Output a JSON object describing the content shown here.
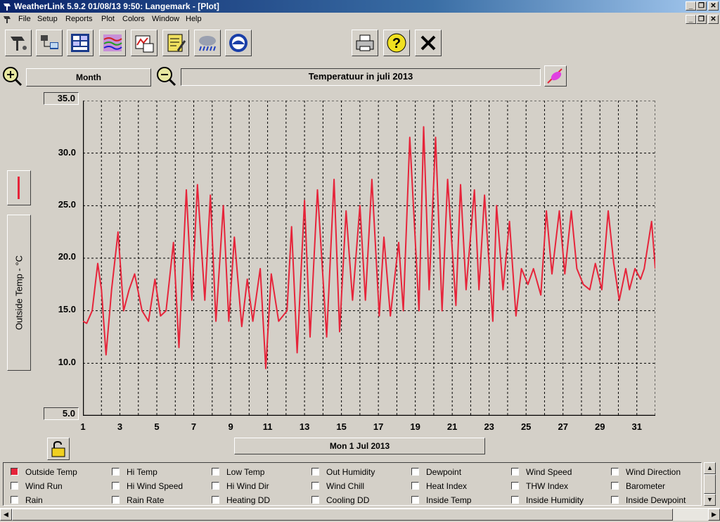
{
  "window": {
    "title": "WeatherLink 5.9.2  01/08/13  9:50: Langemark - [Plot]"
  },
  "menu": [
    "File",
    "Setup",
    "Reports",
    "Plot",
    "Colors",
    "Window",
    "Help"
  ],
  "toolbar_icons": [
    "station-icon",
    "download-icon",
    "bulletin-icon",
    "strip-chart-icon",
    "plot-icon",
    "notes-icon",
    "weather-icon",
    "noaa-icon",
    "print-icon",
    "help-icon",
    "close-icon"
  ],
  "controls": {
    "span": "Month",
    "plot_title": "Temperatuur  in juli 2013",
    "date": "Mon 1 Jul 2013",
    "ylabel": "Outside Temp - °C"
  },
  "colors": {
    "line": "#e6243a",
    "background": "#d4d0c8"
  },
  "legend": [
    [
      "Outside Temp",
      "Hi Temp",
      "Low Temp",
      "Out Humidity",
      "Dewpoint",
      "Wind Speed",
      "Wind Direction"
    ],
    [
      "Wind Run",
      "Hi Wind Speed",
      "Hi Wind Dir",
      "Wind Chill",
      "Heat Index",
      "THW Index",
      "Barometer"
    ],
    [
      "Rain",
      "Rain Rate",
      "Heating DD",
      "Cooling DD",
      "Inside Temp",
      "Inside Humidity",
      "Inside Dewpoint"
    ]
  ],
  "legend_checked": [
    "Outside Temp"
  ],
  "chart_data": {
    "type": "line",
    "ylim": [
      5,
      35
    ],
    "yticks": [
      "35.0",
      "30.0",
      "25.0",
      "20.0",
      "15.0",
      "10.0",
      "5.0"
    ],
    "xlim": [
      1,
      32
    ],
    "xticks": [
      "1",
      "3",
      "5",
      "7",
      "9",
      "11",
      "13",
      "15",
      "17",
      "19",
      "21",
      "23",
      "25",
      "27",
      "29",
      "31"
    ],
    "series": [
      {
        "x": [
          1,
          1.2,
          1.5,
          1.8,
          2.0,
          2.25,
          2.55,
          2.9,
          3.2,
          3.5,
          3.8,
          4.2,
          4.55,
          4.9,
          5.2,
          5.5,
          5.9,
          6.2,
          6.6,
          6.9,
          7.2,
          7.6,
          7.9,
          8.2,
          8.6,
          8.9,
          9.2,
          9.6,
          9.9,
          10.2,
          10.6,
          10.9,
          11.2,
          11.6,
          12.05,
          12.3,
          12.6,
          13.0,
          13.3,
          13.7,
          14.2,
          14.6,
          14.9,
          15.25,
          15.6,
          16.0,
          16.3,
          16.65,
          17.05,
          17.3,
          17.65,
          18.1,
          18.35,
          18.7,
          19.2,
          19.45,
          19.75,
          20.1,
          20.45,
          20.75,
          21.2,
          21.45,
          21.75,
          22.2,
          22.45,
          22.75,
          23.2,
          23.4,
          23.75,
          24.1,
          24.45,
          24.75,
          25.1,
          25.4,
          25.8,
          26.1,
          26.4,
          26.8,
          27.1,
          27.45,
          27.75,
          28.1,
          28.45,
          28.75,
          29.1,
          29.45,
          29.75,
          30.05,
          30.4,
          30.6,
          30.9,
          31.2,
          31.4,
          31.8,
          32.0
        ],
        "y": [
          14.0,
          13.8,
          15.0,
          19.5,
          17.0,
          10.8,
          17.0,
          22.5,
          15.0,
          17.0,
          18.5,
          15.0,
          14.0,
          18.0,
          14.5,
          15.0,
          21.5,
          11.5,
          26.5,
          16.0,
          27.0,
          16.0,
          26.0,
          14.0,
          25.0,
          14.0,
          22.0,
          13.5,
          18.0,
          14.0,
          19.0,
          9.5,
          18.5,
          14.0,
          15.0,
          23.0,
          11.0,
          25.5,
          12.5,
          26.5,
          12.5,
          27.5,
          13.0,
          24.5,
          16.0,
          25.0,
          16.0,
          27.5,
          14.5,
          22.0,
          14.5,
          21.5,
          15.0,
          31.5,
          15.0,
          32.5,
          17.0,
          31.5,
          15.0,
          27.5,
          15.5,
          27.0,
          17.0,
          26.5,
          17.0,
          26.0,
          14.0,
          25.0,
          17.0,
          23.5,
          14.5,
          19.0,
          17.5,
          19.0,
          16.5,
          24.5,
          18.5,
          24.5,
          18.5,
          24.5,
          19.0,
          17.5,
          17.0,
          19.5,
          17.0,
          24.5,
          19.5,
          16.0,
          19.0,
          17.0,
          19.0,
          18.0,
          19.0,
          23.5,
          19.0
        ]
      }
    ]
  }
}
